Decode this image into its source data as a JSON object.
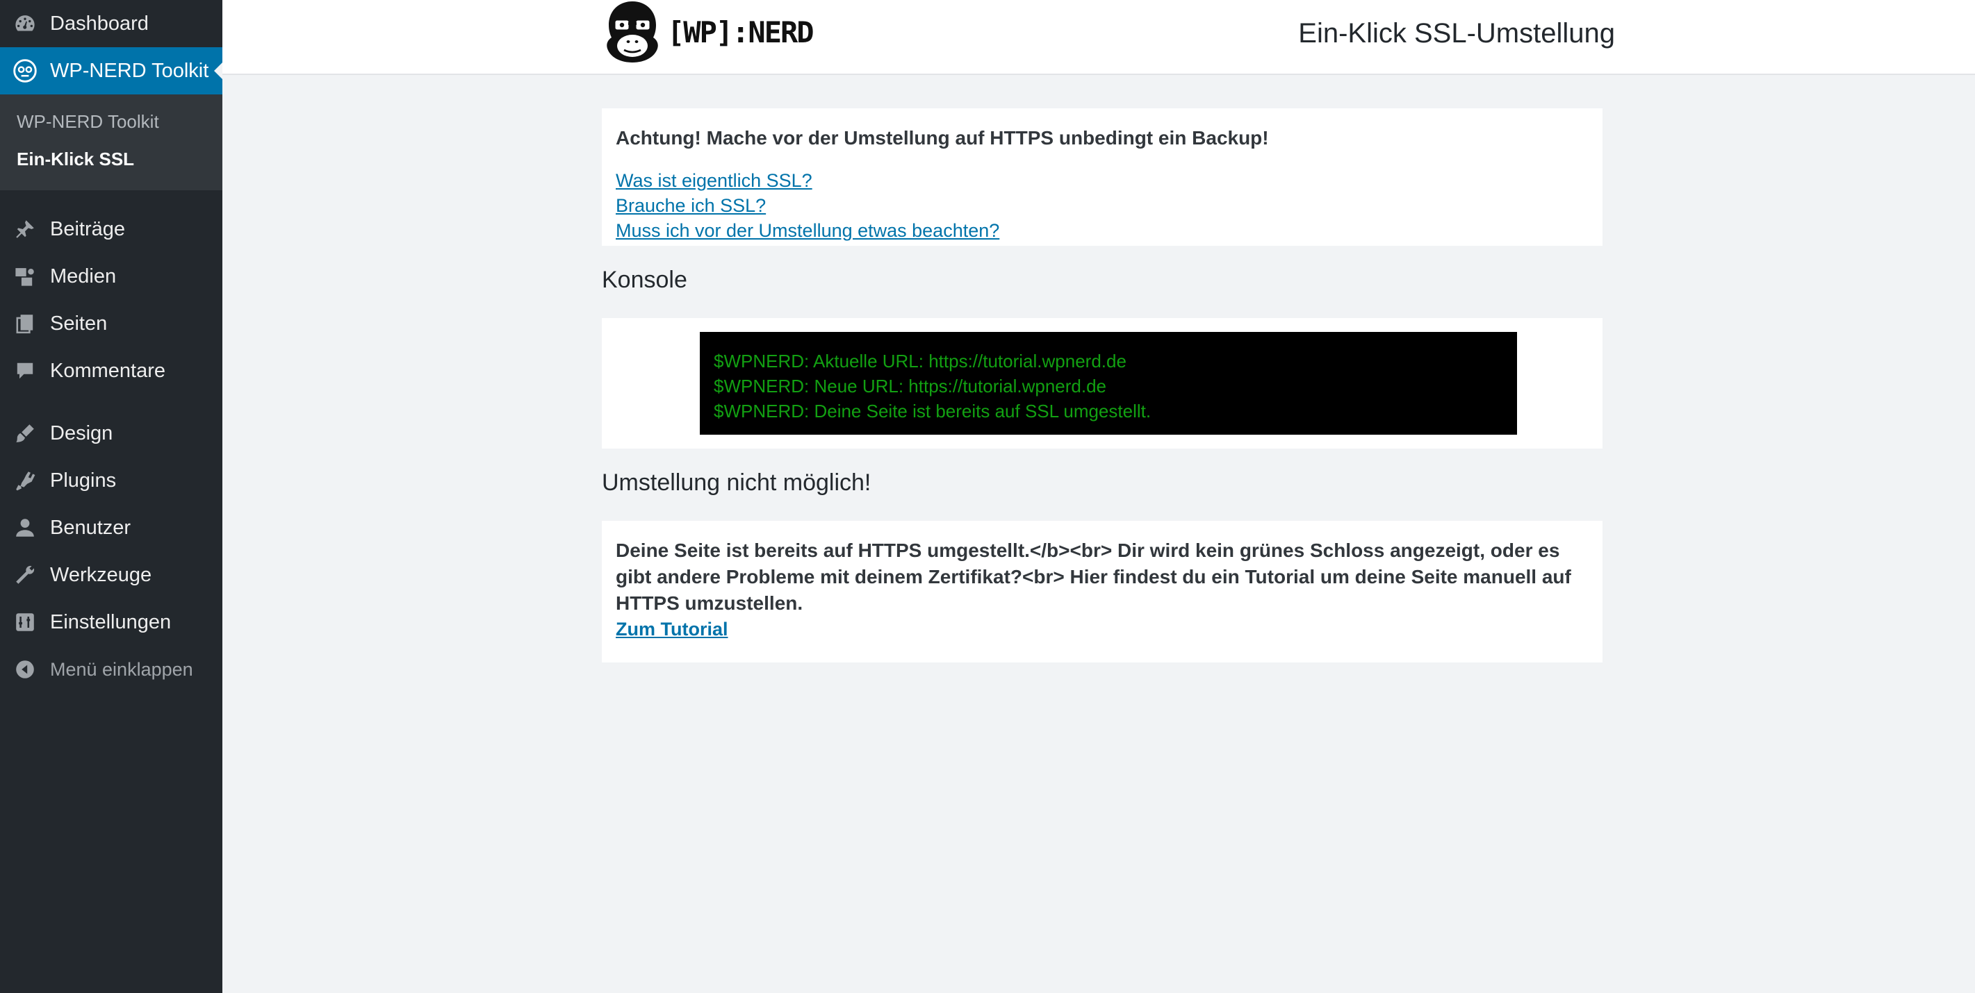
{
  "sidebar": {
    "top_items": [
      {
        "label": "Dashboard",
        "icon": "dashboard-icon"
      },
      {
        "label": "WP-NERD Toolkit",
        "icon": "nerd-toolkit-icon"
      }
    ],
    "submenu": [
      {
        "label": "WP-NERD Toolkit"
      },
      {
        "label": "Ein-Klick SSL"
      }
    ],
    "group1": [
      {
        "label": "Beiträge",
        "icon": "pin-icon"
      },
      {
        "label": "Medien",
        "icon": "media-icon"
      },
      {
        "label": "Seiten",
        "icon": "pages-icon"
      },
      {
        "label": "Kommentare",
        "icon": "comment-icon"
      }
    ],
    "group2": [
      {
        "label": "Design",
        "icon": "brush-icon"
      },
      {
        "label": "Plugins",
        "icon": "plugin-icon"
      },
      {
        "label": "Benutzer",
        "icon": "user-icon"
      },
      {
        "label": "Werkzeuge",
        "icon": "wrench-icon"
      },
      {
        "label": "Einstellungen",
        "icon": "settings-icon"
      }
    ],
    "collapse_label": "Menü einklappen"
  },
  "header": {
    "logo_text": "[WP]:NERD",
    "title": "Ein-Klick SSL-Umstellung"
  },
  "notice": {
    "warning": "Achtung! Mache vor der Umstellung auf HTTPS unbedingt ein Backup!",
    "links": [
      "Was ist eigentlich SSL?",
      "Brauche ich SSL?",
      "Muss ich vor der Umstellung etwas beachten?"
    ]
  },
  "console": {
    "title": "Konsole",
    "lines": [
      "$WPNERD: Aktuelle URL: https://tutorial.wpnerd.de",
      "$WPNERD: Neue URL: https://tutorial.wpnerd.de",
      "$WPNERD: Deine Seite ist bereits auf SSL umgestellt."
    ]
  },
  "result": {
    "title": "Umstellung nicht möglich!",
    "message": "Deine Seite ist bereits auf HTTPS umgestellt.</b><br> Dir wird kein grünes Schloss angezeigt, oder es gibt andere Probleme mit deinem Zertifikat?<br> Hier findest du ein Tutorial um deine Seite manuell auf HTTPS umzustellen.",
    "link": "Zum Tutorial"
  },
  "colors": {
    "sidebar_bg": "#23282d",
    "active_bg": "#0073aa",
    "link": "#0073aa",
    "console_text": "#12a012"
  }
}
